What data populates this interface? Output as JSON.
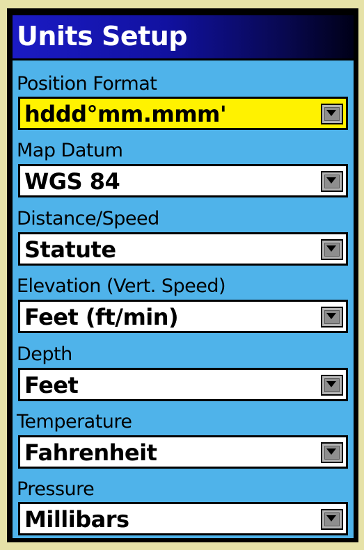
{
  "screen": {
    "title": "Units Setup"
  },
  "fields": [
    {
      "label": "Position Format",
      "value": "hddd°mm.mmm'",
      "selected": true
    },
    {
      "label": "Map Datum",
      "value": "WGS 84",
      "selected": false
    },
    {
      "label": "Distance/Speed",
      "value": "Statute",
      "selected": false
    },
    {
      "label": "Elevation (Vert. Speed)",
      "value": "Feet (ft/min)",
      "selected": false
    },
    {
      "label": "Depth",
      "value": "Feet",
      "selected": false
    },
    {
      "label": "Temperature",
      "value": "Fahrenheit",
      "selected": false
    },
    {
      "label": "Pressure",
      "value": "Millibars",
      "selected": false
    }
  ],
  "colors": {
    "title_gradient_start": "#1b1bc4",
    "screen_background": "#4fb3ea",
    "selected_field": "#fff200",
    "field_background": "#ffffff",
    "page_background": "#e6e2a8"
  },
  "icons": {
    "dropdown": "dropdown-arrow-icon"
  }
}
